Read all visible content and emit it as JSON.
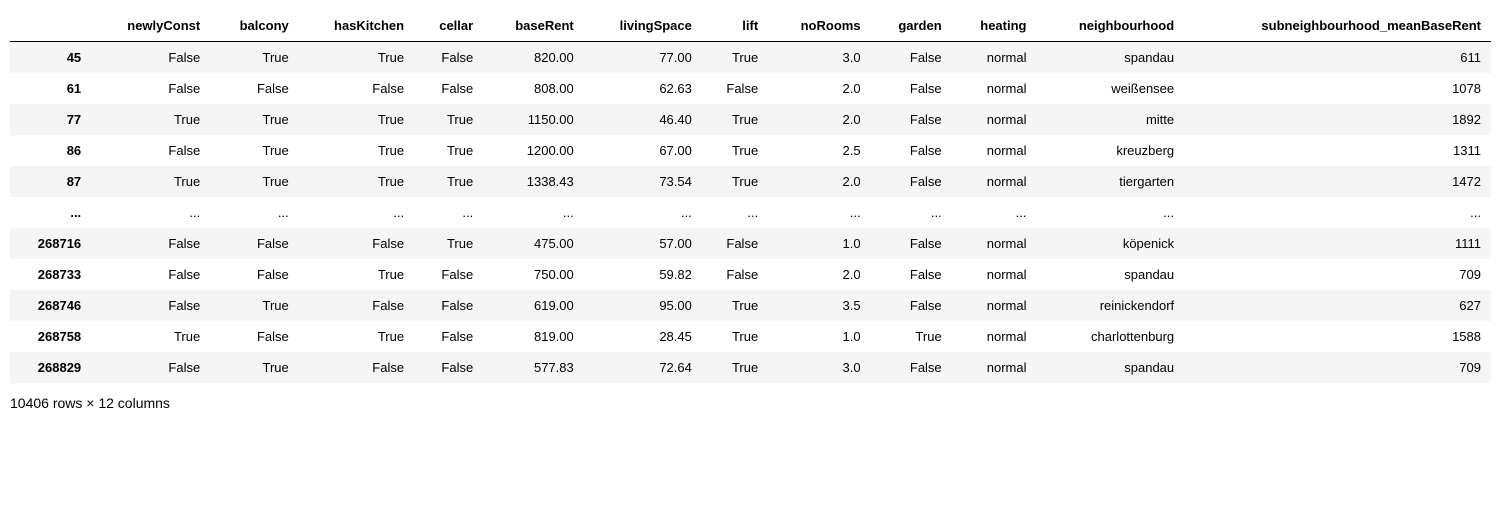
{
  "table": {
    "columns": [
      "newlyConst",
      "balcony",
      "hasKitchen",
      "cellar",
      "baseRent",
      "livingSpace",
      "lift",
      "noRooms",
      "garden",
      "heating",
      "neighbourhood",
      "subneighbourhood_meanBaseRent"
    ],
    "rows": [
      {
        "idx": "45",
        "cells": [
          "False",
          "True",
          "True",
          "False",
          "820.00",
          "77.00",
          "True",
          "3.0",
          "False",
          "normal",
          "spandau",
          "611"
        ]
      },
      {
        "idx": "61",
        "cells": [
          "False",
          "False",
          "False",
          "False",
          "808.00",
          "62.63",
          "False",
          "2.0",
          "False",
          "normal",
          "weißensee",
          "1078"
        ]
      },
      {
        "idx": "77",
        "cells": [
          "True",
          "True",
          "True",
          "True",
          "1150.00",
          "46.40",
          "True",
          "2.0",
          "False",
          "normal",
          "mitte",
          "1892"
        ]
      },
      {
        "idx": "86",
        "cells": [
          "False",
          "True",
          "True",
          "True",
          "1200.00",
          "67.00",
          "True",
          "2.5",
          "False",
          "normal",
          "kreuzberg",
          "1311"
        ]
      },
      {
        "idx": "87",
        "cells": [
          "True",
          "True",
          "True",
          "True",
          "1338.43",
          "73.54",
          "True",
          "2.0",
          "False",
          "normal",
          "tiergarten",
          "1472"
        ]
      },
      {
        "idx": "...",
        "cells": [
          "...",
          "...",
          "...",
          "...",
          "...",
          "...",
          "...",
          "...",
          "...",
          "...",
          "...",
          "..."
        ]
      },
      {
        "idx": "268716",
        "cells": [
          "False",
          "False",
          "False",
          "True",
          "475.00",
          "57.00",
          "False",
          "1.0",
          "False",
          "normal",
          "köpenick",
          "1111"
        ]
      },
      {
        "idx": "268733",
        "cells": [
          "False",
          "False",
          "True",
          "False",
          "750.00",
          "59.82",
          "False",
          "2.0",
          "False",
          "normal",
          "spandau",
          "709"
        ]
      },
      {
        "idx": "268746",
        "cells": [
          "False",
          "True",
          "False",
          "False",
          "619.00",
          "95.00",
          "True",
          "3.5",
          "False",
          "normal",
          "reinickendorf",
          "627"
        ]
      },
      {
        "idx": "268758",
        "cells": [
          "True",
          "False",
          "True",
          "False",
          "819.00",
          "28.45",
          "True",
          "1.0",
          "True",
          "normal",
          "charlottenburg",
          "1588"
        ]
      },
      {
        "idx": "268829",
        "cells": [
          "False",
          "True",
          "False",
          "False",
          "577.83",
          "72.64",
          "True",
          "3.0",
          "False",
          "normal",
          "spandau",
          "709"
        ]
      }
    ]
  },
  "footer": "10406 rows × 12 columns"
}
